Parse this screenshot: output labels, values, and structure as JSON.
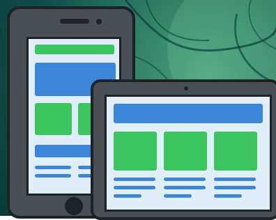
{
  "illustration": {
    "subject": "responsive-devices",
    "colors": {
      "background": "#2e7d64",
      "device_body": "#4a4f55",
      "device_outline": "#1d2227",
      "screen": "#dfeef7",
      "green_block": "#3cc45e",
      "blue_block": "#3b86d8"
    },
    "icons": [
      "phone-icon",
      "tablet-icon"
    ]
  }
}
